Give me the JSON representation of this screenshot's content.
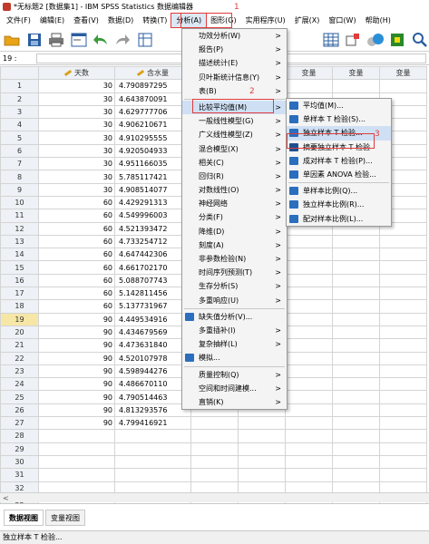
{
  "window": {
    "title": "*无标题2 [数据集1] - IBM SPSS Statistics 数据编辑器"
  },
  "menubar": [
    "文件(F)",
    "编辑(E)",
    "查看(V)",
    "数据(D)",
    "转换(T)",
    "分析(A)",
    "图形(G)",
    "实用程序(U)",
    "扩展(X)",
    "窗口(W)",
    "帮助(H)"
  ],
  "cellref": "19 :",
  "grid": {
    "columns": [
      "天数",
      "含水量",
      "变量",
      "变量",
      "变量",
      "变量",
      "变量"
    ],
    "rows": [
      {
        "n": "1",
        "a": "30",
        "b": "4.790897295"
      },
      {
        "n": "2",
        "a": "30",
        "b": "4.643870091"
      },
      {
        "n": "3",
        "a": "30",
        "b": "4.629777706"
      },
      {
        "n": "4",
        "a": "30",
        "b": "4.906210671"
      },
      {
        "n": "5",
        "a": "30",
        "b": "4.910295555"
      },
      {
        "n": "6",
        "a": "30",
        "b": "4.920504933"
      },
      {
        "n": "7",
        "a": "30",
        "b": "4.951166035"
      },
      {
        "n": "8",
        "a": "30",
        "b": "5.785117421"
      },
      {
        "n": "9",
        "a": "30",
        "b": "4.908514077"
      },
      {
        "n": "10",
        "a": "60",
        "b": "4.429291313"
      },
      {
        "n": "11",
        "a": "60",
        "b": "4.549996003"
      },
      {
        "n": "12",
        "a": "60",
        "b": "4.521393472"
      },
      {
        "n": "13",
        "a": "60",
        "b": "4.733254712"
      },
      {
        "n": "14",
        "a": "60",
        "b": "4.647442306"
      },
      {
        "n": "15",
        "a": "60",
        "b": "4.661702170"
      },
      {
        "n": "16",
        "a": "60",
        "b": "5.088707743"
      },
      {
        "n": "17",
        "a": "60",
        "b": "5.142811456"
      },
      {
        "n": "18",
        "a": "60",
        "b": "5.137731967"
      },
      {
        "n": "19",
        "a": "90",
        "b": "4.449534916"
      },
      {
        "n": "20",
        "a": "90",
        "b": "4.434679569"
      },
      {
        "n": "21",
        "a": "90",
        "b": "4.473631840"
      },
      {
        "n": "22",
        "a": "90",
        "b": "4.520107978"
      },
      {
        "n": "23",
        "a": "90",
        "b": "4.598944276"
      },
      {
        "n": "24",
        "a": "90",
        "b": "4.486670110"
      },
      {
        "n": "25",
        "a": "90",
        "b": "4.790514463"
      },
      {
        "n": "26",
        "a": "90",
        "b": "4.813293576"
      },
      {
        "n": "27",
        "a": "90",
        "b": "4.799416921"
      },
      {
        "n": "28",
        "a": "",
        "b": ""
      },
      {
        "n": "29",
        "a": "",
        "b": ""
      },
      {
        "n": "30",
        "a": "",
        "b": ""
      },
      {
        "n": "31",
        "a": "",
        "b": ""
      },
      {
        "n": "32",
        "a": "",
        "b": ""
      },
      {
        "n": "33",
        "a": "",
        "b": ""
      }
    ],
    "selected_row": "19",
    "scroll_left_arrow": "<"
  },
  "analyze_menu": [
    {
      "label": "功效分析(W)",
      "arrow": ">"
    },
    {
      "label": "报告(P)",
      "arrow": ">"
    },
    {
      "label": "描述统计(E)",
      "arrow": ">"
    },
    {
      "label": "贝叶斯统计信息(Y)",
      "arrow": ">"
    },
    {
      "label": "表(B)",
      "arrow": ">"
    },
    {
      "label": "比较平均值(M)",
      "arrow": ">",
      "hl": true
    },
    {
      "label": "一般线性模型(G)",
      "arrow": ">"
    },
    {
      "label": "广义线性模型(Z)",
      "arrow": ">"
    },
    {
      "label": "混合模型(X)",
      "arrow": ">"
    },
    {
      "label": "相关(C)",
      "arrow": ">"
    },
    {
      "label": "回归(R)",
      "arrow": ">"
    },
    {
      "label": "对数线性(O)",
      "arrow": ">"
    },
    {
      "label": "神经网络",
      "arrow": ">"
    },
    {
      "label": "分类(F)",
      "arrow": ">"
    },
    {
      "label": "降维(D)",
      "arrow": ">"
    },
    {
      "label": "刻度(A)",
      "arrow": ">"
    },
    {
      "label": "非参数检验(N)",
      "arrow": ">"
    },
    {
      "label": "时间序列预测(T)",
      "arrow": ">"
    },
    {
      "label": "生存分析(S)",
      "arrow": ">"
    },
    {
      "label": "多重响应(U)",
      "arrow": ">"
    },
    {
      "label": "缺失值分析(V)...",
      "arrow": "",
      "icon": true
    },
    {
      "label": "多重插补(I)",
      "arrow": ">"
    },
    {
      "label": "复杂抽样(L)",
      "arrow": ">"
    },
    {
      "label": "模拟...",
      "arrow": "",
      "icon": true
    },
    {
      "label": "质量控制(Q)",
      "arrow": ">"
    },
    {
      "label": "空间和时间建模...",
      "arrow": ">"
    },
    {
      "label": "直销(K)",
      "arrow": ">"
    }
  ],
  "compare_means_menu": [
    {
      "label": "平均值(M)..."
    },
    {
      "label": "单样本 T 检验(S)..."
    },
    {
      "label": "独立样本 T 检验...",
      "hl": true
    },
    {
      "label": "摘要独立样本 T 检验"
    },
    {
      "label": "成对样本 T 检验(P)..."
    },
    {
      "label": "单因素 ANOVA 检验..."
    },
    {
      "label": "单样本比例(Q)..."
    },
    {
      "label": "独立样本比例(R)..."
    },
    {
      "label": "配对样本比例(L)..."
    }
  ],
  "annotations": [
    "1",
    "2",
    "3"
  ],
  "tabs": [
    "数据视图",
    "变量视图"
  ],
  "status": "独立样本 T 检验...",
  "colors": {
    "accent_red": "#e23b3b",
    "highlight": "#cfe0f4",
    "row_select": "#f7e7a6"
  }
}
